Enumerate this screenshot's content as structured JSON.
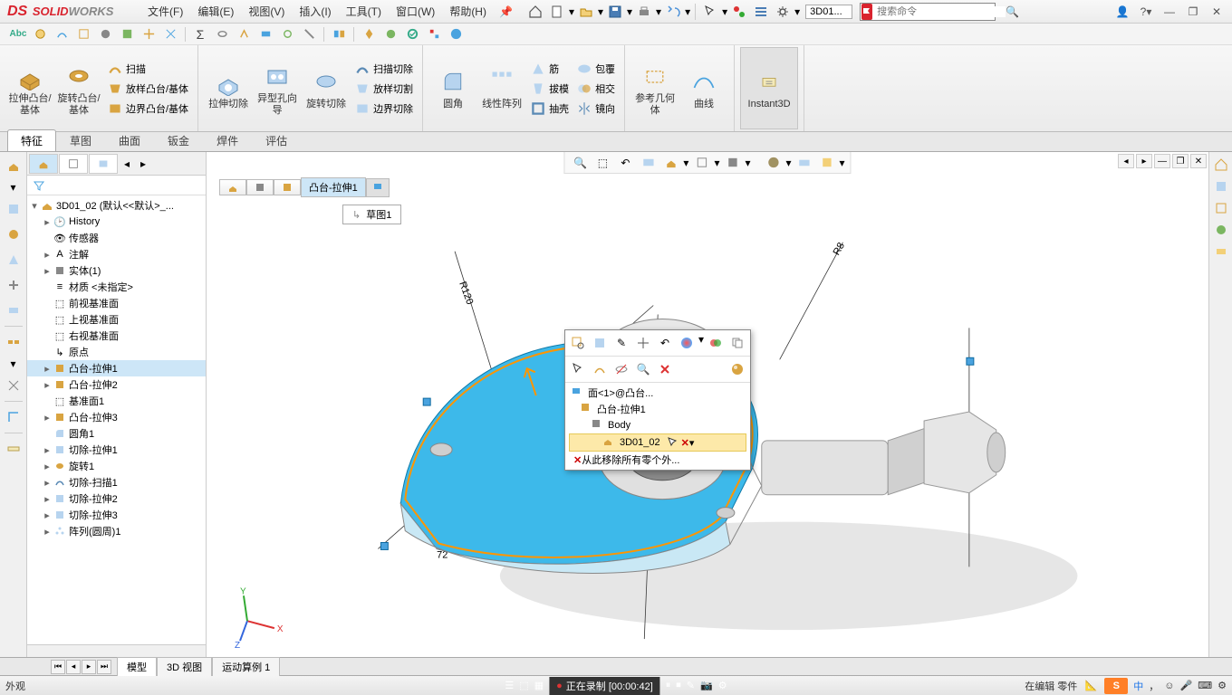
{
  "menu": {
    "file": "文件(F)",
    "edit": "编辑(E)",
    "view": "视图(V)",
    "insert": "插入(I)",
    "tools": "工具(T)",
    "window": "窗口(W)",
    "help": "帮助(H)"
  },
  "doc_name": "3D01...",
  "search_placeholder": "搜索命令",
  "ribbon": {
    "extrude": "拉伸凸台/基体",
    "revolve": "旋转凸台/基体",
    "sweep": "扫描",
    "loft": "放样凸台/基体",
    "boundary": "边界凸台/基体",
    "cut_extrude": "拉伸切除",
    "hole": "异型孔向导",
    "cut_revolve": "旋转切除",
    "cut_sweep": "扫描切除",
    "cut_loft": "放样切割",
    "cut_boundary": "边界切除",
    "fillet": "圆角",
    "pattern": "线性阵列",
    "rib": "筋",
    "draft": "拔模",
    "shell": "抽壳",
    "wrap": "包覆",
    "intersect": "相交",
    "mirror": "镜向",
    "refgeom": "参考几何体",
    "curves": "曲线",
    "instant": "Instant3D"
  },
  "tabs": {
    "feature": "特征",
    "sketch": "草图",
    "surface": "曲面",
    "sheetmetal": "钣金",
    "weld": "焊件",
    "eval": "评估"
  },
  "tree": {
    "root": "3D01_02 (默认<<默认>_...",
    "items": [
      "History",
      "传感器",
      "注解",
      "实体(1)",
      "材质 <未指定>",
      "前视基准面",
      "上视基准面",
      "右视基准面",
      "原点",
      "凸台-拉伸1",
      "凸台-拉伸2",
      "基准面1",
      "凸台-拉伸3",
      "圆角1",
      "切除-拉伸1",
      "旋转1",
      "切除-扫描1",
      "切除-拉伸2",
      "切除-拉伸3",
      "阵列(圆周)1"
    ]
  },
  "breadcrumb": {
    "item": "凸台-拉伸1"
  },
  "sketch_tag": "草图1",
  "context": {
    "face": "面<1>@凸台...",
    "extrude": "凸台-拉伸1",
    "body": "Body",
    "part": "3D01_02",
    "remove": "从此移除所有零个外..."
  },
  "bottom_tabs": {
    "model": "模型",
    "view3d": "3D 视图",
    "motion": "运动算例 1"
  },
  "status": {
    "left": "外观",
    "rec": "正在录制 [00:00:42]",
    "editing": "在编辑 零件",
    "ime_char": "中"
  },
  "dims": {
    "r120": "R120",
    "r8": "R8",
    "d72": "72"
  },
  "colors": {
    "accent": "#cde6f7",
    "highlight": "#3db9ea"
  }
}
